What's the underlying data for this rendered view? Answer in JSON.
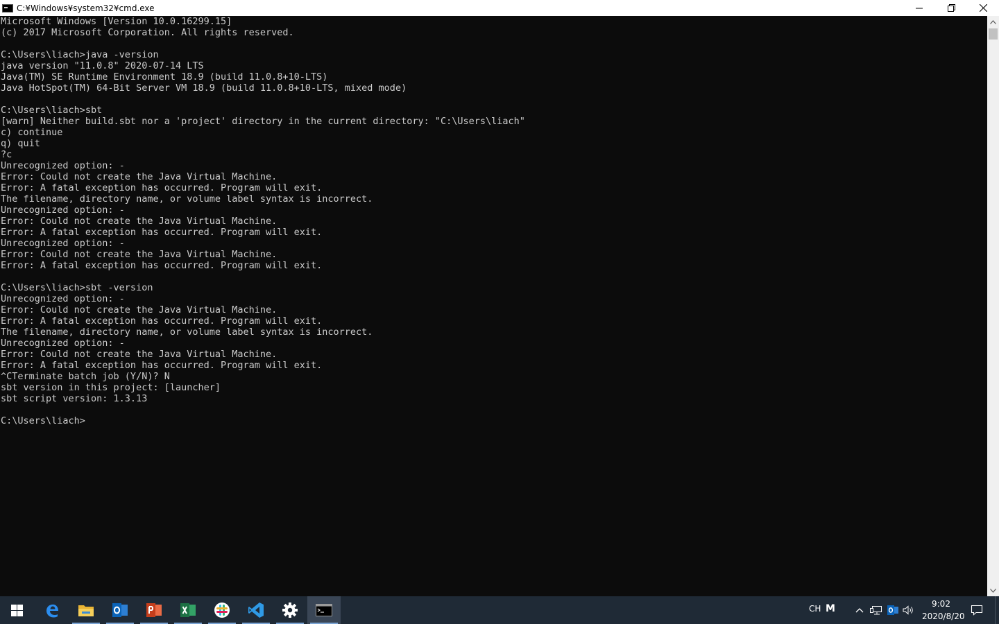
{
  "window": {
    "title": "C:¥Windows¥system32¥cmd.exe"
  },
  "console": {
    "lines": [
      "Microsoft Windows [Version 10.0.16299.15]",
      "(c) 2017 Microsoft Corporation. All rights reserved.",
      "",
      "C:\\Users\\liach>java -version",
      "java version \"11.0.8\" 2020-07-14 LTS",
      "Java(TM) SE Runtime Environment 18.9 (build 11.0.8+10-LTS)",
      "Java HotSpot(TM) 64-Bit Server VM 18.9 (build 11.0.8+10-LTS, mixed mode)",
      "",
      "C:\\Users\\liach>sbt",
      "[warn] Neither build.sbt nor a 'project' directory in the current directory: \"C:\\Users\\liach\"",
      "c) continue",
      "q) quit",
      "?c",
      "Unrecognized option: -",
      "Error: Could not create the Java Virtual Machine.",
      "Error: A fatal exception has occurred. Program will exit.",
      "The filename, directory name, or volume label syntax is incorrect.",
      "Unrecognized option: -",
      "Error: Could not create the Java Virtual Machine.",
      "Error: A fatal exception has occurred. Program will exit.",
      "Unrecognized option: -",
      "Error: Could not create the Java Virtual Machine.",
      "Error: A fatal exception has occurred. Program will exit.",
      "",
      "C:\\Users\\liach>sbt -version",
      "Unrecognized option: -",
      "Error: Could not create the Java Virtual Machine.",
      "Error: A fatal exception has occurred. Program will exit.",
      "The filename, directory name, or volume label syntax is incorrect.",
      "Unrecognized option: -",
      "Error: Could not create the Java Virtual Machine.",
      "Error: A fatal exception has occurred. Program will exit.",
      "^CTerminate batch job (Y/N)? N",
      "sbt version in this project: [launcher]",
      "sbt script version: 1.3.13",
      "",
      "C:\\Users\\liach>"
    ]
  },
  "taskbar": {
    "apps": [
      {
        "name": "edge-icon",
        "running": false
      },
      {
        "name": "file-explorer-icon",
        "running": true
      },
      {
        "name": "outlook-icon",
        "running": true
      },
      {
        "name": "powerpoint-icon",
        "running": true
      },
      {
        "name": "excel-icon",
        "running": true
      },
      {
        "name": "slack-icon",
        "running": true
      },
      {
        "name": "vscode-icon",
        "running": true
      },
      {
        "name": "settings-icon",
        "running": true
      },
      {
        "name": "command-prompt-icon",
        "running": true,
        "active": true
      }
    ]
  },
  "tray": {
    "language": "CH",
    "ime": "M",
    "time": "9:02",
    "date": "2020/8/20"
  },
  "colors": {
    "console_bg": "#0c0c0c",
    "console_fg": "#cccccc",
    "taskbar_bg": "#1f2a36",
    "accent": "#7aa4d4"
  }
}
